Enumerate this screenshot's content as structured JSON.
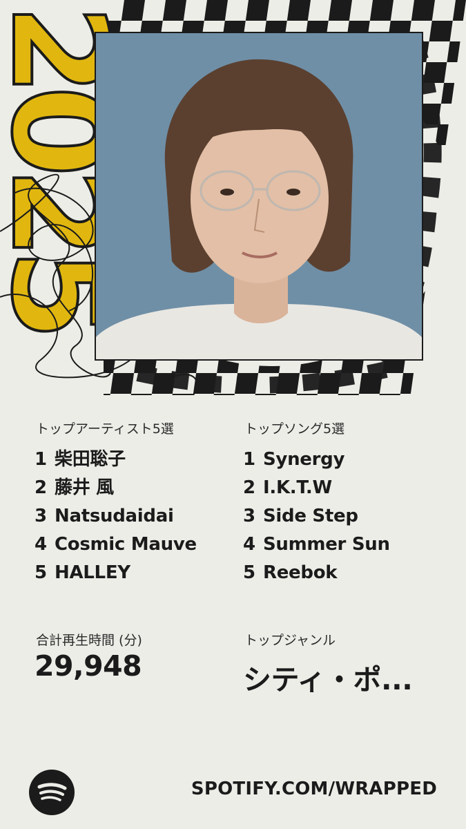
{
  "year_badge": "2025",
  "top_artists": {
    "label": "トップアーティスト5選",
    "items": [
      {
        "rank": "1",
        "name": "柴田聡子"
      },
      {
        "rank": "2",
        "name": "藤井 風"
      },
      {
        "rank": "3",
        "name": "Natsudaidai"
      },
      {
        "rank": "4",
        "name": "Cosmic Mauve"
      },
      {
        "rank": "5",
        "name": "HALLEY"
      }
    ]
  },
  "top_songs": {
    "label": "トップソング5選",
    "items": [
      {
        "rank": "1",
        "name": "Synergy"
      },
      {
        "rank": "2",
        "name": "I.K.T.W"
      },
      {
        "rank": "3",
        "name": "Side Step"
      },
      {
        "rank": "4",
        "name": "Summer Sun"
      },
      {
        "rank": "5",
        "name": "Reebok"
      }
    ]
  },
  "minutes": {
    "label": "合計再生時間 (分)",
    "value": "29,948"
  },
  "top_genre": {
    "label": "トップジャンル",
    "value": "シティ・ポ..."
  },
  "footer": {
    "logo_icon": "spotify-logo-icon",
    "url": "SPOTIFY.COM/WRAPPED"
  },
  "colors": {
    "background": "#EDEDE8",
    "accent_yellow": "#E1B70F",
    "ink": "#1B1B1B",
    "photo_bg": "#6F8FA6"
  }
}
